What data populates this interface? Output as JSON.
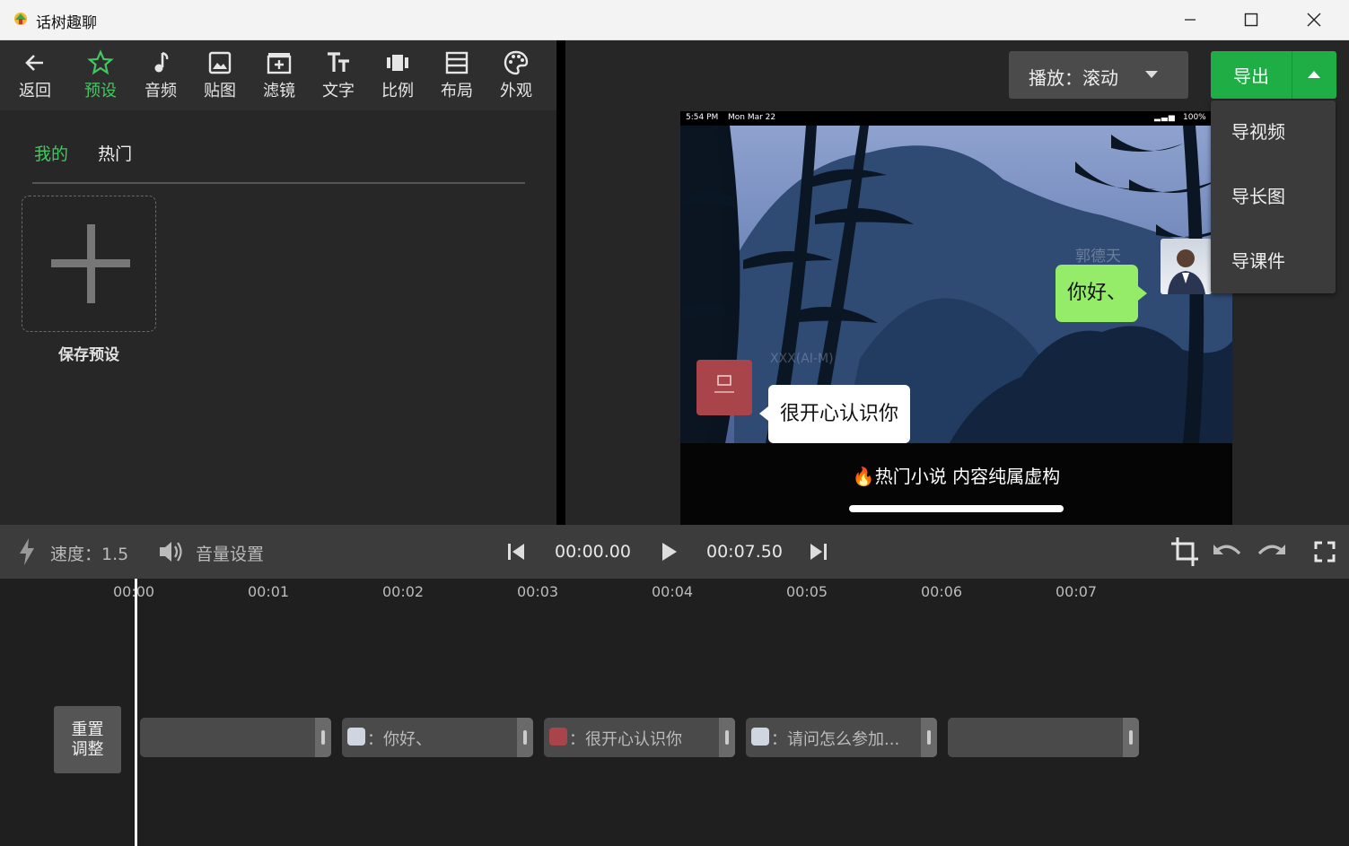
{
  "window": {
    "title": "话树趣聊"
  },
  "toolbar": {
    "items": [
      {
        "label": "返回",
        "icon": "arrow-left-icon"
      },
      {
        "label": "预设",
        "icon": "star-icon"
      },
      {
        "label": "音频",
        "icon": "music-note-icon"
      },
      {
        "label": "贴图",
        "icon": "image-icon"
      },
      {
        "label": "滤镜",
        "icon": "film-filter-icon"
      },
      {
        "label": "文字",
        "icon": "text-icon"
      },
      {
        "label": "比例",
        "icon": "aspect-ratio-icon"
      },
      {
        "label": "布局",
        "icon": "layout-icon"
      },
      {
        "label": "外观",
        "icon": "palette-icon"
      }
    ],
    "active_color": "#43c760"
  },
  "presets": {
    "tabs": [
      "我的",
      "热门"
    ],
    "save_label": "保存预设"
  },
  "playback": {
    "mode_label": "播放：滚动"
  },
  "export": {
    "label": "导出",
    "menu": [
      "导视频",
      "导长图",
      "导课件"
    ],
    "color": "#1fae45"
  },
  "preview": {
    "status_time": "5:54 PM",
    "status_date": "Mon Mar 22",
    "battery": "100%",
    "name_right": "郭德天",
    "bubble_right": "你好、",
    "name_left": "XXX(AI-M)",
    "bubble_left": "很开心认识你",
    "caption": "🔥热门小说 内容纯属虚构"
  },
  "controls": {
    "speed_label": "速度：1.5",
    "volume_label": "音量设置",
    "current_time": "00:00.00",
    "total_time": "00:07.50"
  },
  "timeline": {
    "ticks": [
      "00:00",
      "00:01",
      "00:02",
      "00:03",
      "00:04",
      "00:05",
      "00:06",
      "00:07"
    ],
    "reset_label_1": "重置",
    "reset_label_2": "调整",
    "clips": [
      {
        "text": ""
      },
      {
        "text": "：你好、"
      },
      {
        "text": "：很开心认识你"
      },
      {
        "text": "：请问怎么参加..."
      },
      {
        "text": ""
      }
    ]
  }
}
